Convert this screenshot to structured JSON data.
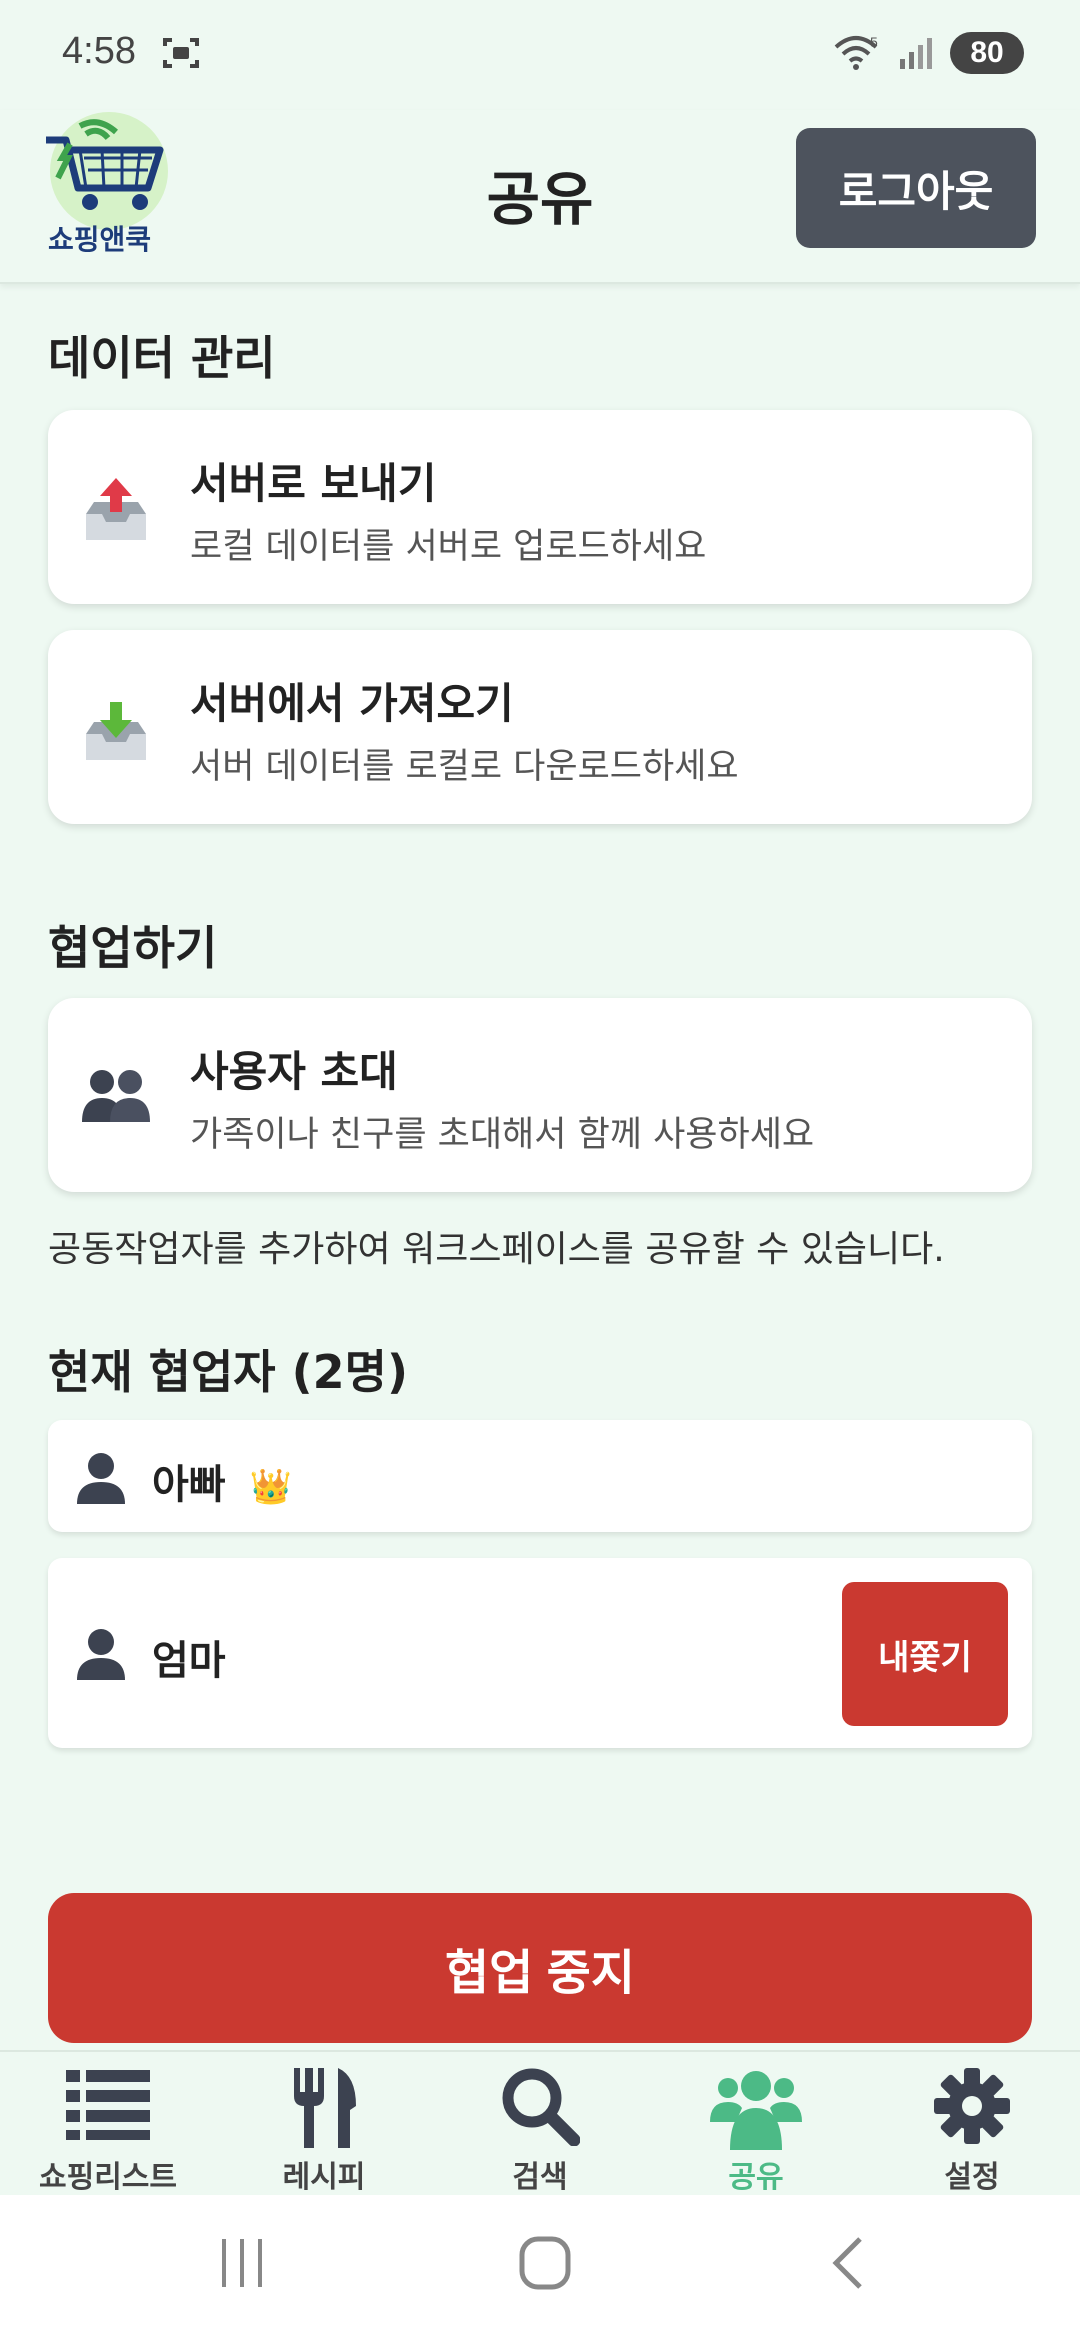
{
  "status_bar": {
    "time": "4:58",
    "battery": "80"
  },
  "header": {
    "logo_text": "쇼핑앤쿡",
    "title": "공유",
    "logout_label": "로그아웃"
  },
  "data_section": {
    "title": "데이터 관리",
    "items": [
      {
        "title": "서버로 보내기",
        "subtitle": "로컬 데이터를 서버로 업로드하세요"
      },
      {
        "title": "서버에서 가져오기",
        "subtitle": "서버 데이터를 로컬로 다운로드하세요"
      }
    ]
  },
  "collab_section": {
    "title": "협업하기",
    "invite": {
      "title": "사용자 초대",
      "subtitle": "가족이나 친구를 초대해서 함께 사용하세요"
    },
    "note": "공동작업자를 추가하여 워크스페이스를 공유할 수 있습니다."
  },
  "collaborators": {
    "title": "현재 협업자 (2명)",
    "list": [
      {
        "name": "아빠",
        "badge": "👑"
      },
      {
        "name": "엄마",
        "action": "내쫓기"
      }
    ]
  },
  "stop_label": "협업 중지",
  "tabs": [
    {
      "label": "쇼핑리스트",
      "icon": "list-icon"
    },
    {
      "label": "레시피",
      "icon": "fork-knife-icon"
    },
    {
      "label": "검색",
      "icon": "search-icon"
    },
    {
      "label": "공유",
      "icon": "users-icon",
      "active": true
    },
    {
      "label": "설정",
      "icon": "gear-icon"
    }
  ],
  "colors": {
    "accent": "#4CBA86",
    "danger": "#CA3930",
    "dark_button": "#4D535D",
    "background": "#EEF9F2"
  }
}
